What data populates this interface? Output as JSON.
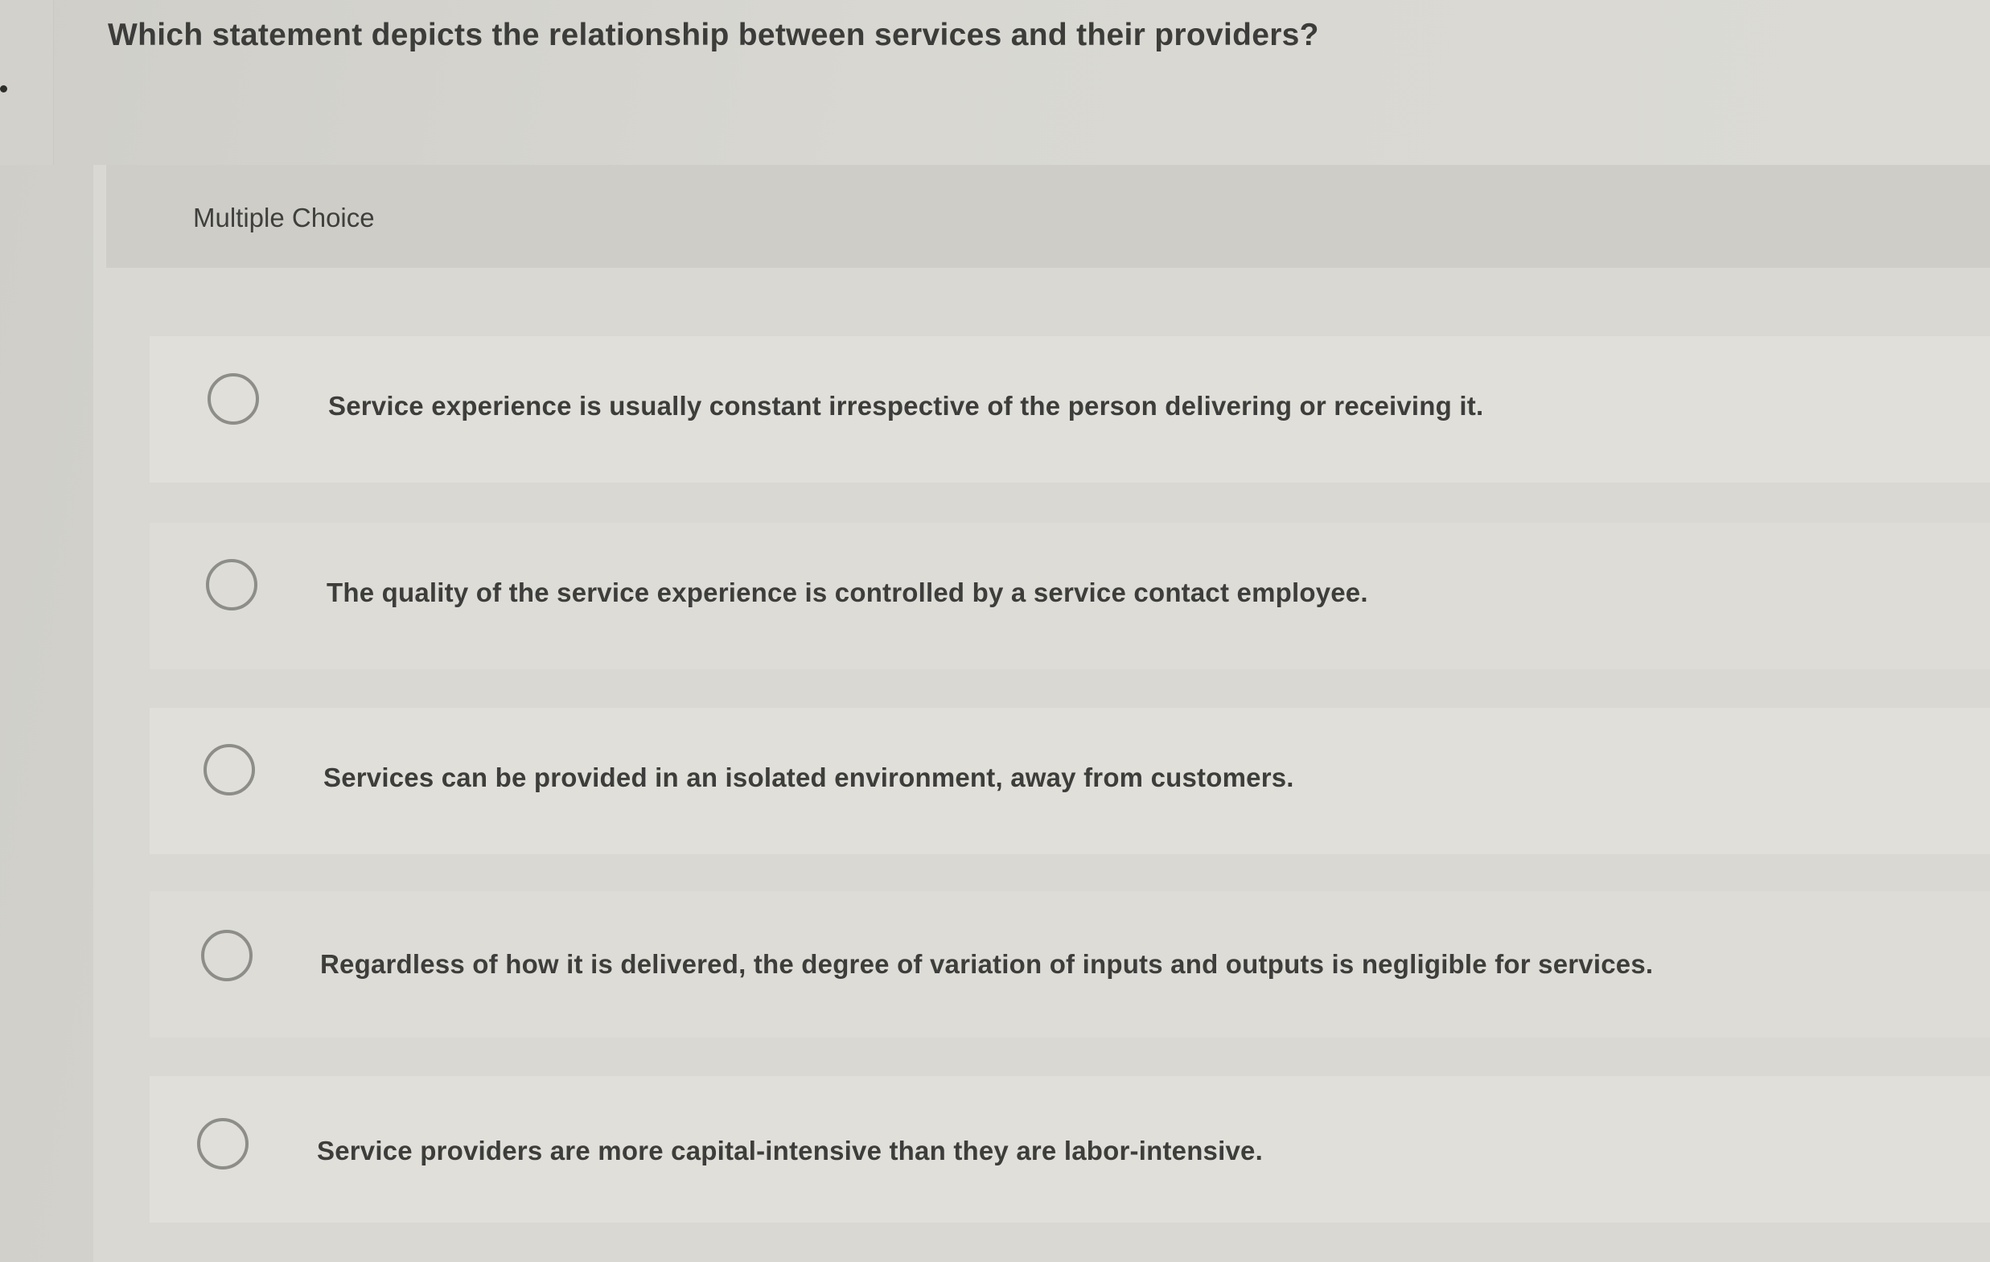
{
  "question": {
    "text": "Which statement depicts the relationship between services and their providers?"
  },
  "multiple_choice": {
    "label": "Multiple Choice",
    "options": [
      {
        "label": "Service experience is usually constant irrespective of the person delivering or receiving it.",
        "selected": false
      },
      {
        "label": "The quality of the service experience is controlled by a service contact employee.",
        "selected": false
      },
      {
        "label": "Services can be provided in an isolated environment, away from customers.",
        "selected": false
      },
      {
        "label": "Regardless of how it is delivered, the degree of variation of inputs and outputs is negligible for services.",
        "selected": false
      },
      {
        "label": "Service providers are more capital-intensive than they are labor-intensive.",
        "selected": false
      }
    ]
  }
}
